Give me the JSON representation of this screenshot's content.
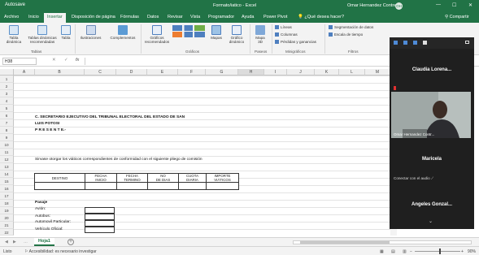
{
  "window": {
    "autosave": "Autosave",
    "title": "Formato/iatico - Excel",
    "user": "Omar Hernandez Contreras",
    "user_initials": "OH",
    "minimize": "—",
    "maximize": "☐",
    "close": "✕"
  },
  "ribbon_tabs": [
    "Archivo",
    "Inicio",
    "Insertar",
    "Disposición de página",
    "Fórmulas",
    "Datos",
    "Revisar",
    "Vista",
    "Programador",
    "Ayuda",
    "Power Pivot"
  ],
  "active_tab": "Insertar",
  "tell_me": "¿Qué desea hacer?",
  "share": "Compartir",
  "ribbon": {
    "tabla_dinamica": [
      "Tabla",
      "dinámica"
    ],
    "tablas_recomendadas": [
      "Tablas dinámicas",
      "recomendadas"
    ],
    "tabla": "Tabla",
    "ilustraciones": "Ilustraciones",
    "complementos": "Complementos",
    "graficos_recomendados": [
      "Gráficos",
      "recomendados"
    ],
    "mapas": "Mapas",
    "grafico_dinamico": [
      "Gráfico",
      "dinámico"
    ],
    "mapa_3d": [
      "Mapa",
      "3D"
    ],
    "lineas": "Líneas",
    "columnas": "Columnas",
    "perdidas": "Pérdidas y ganancias",
    "segmentacion": "Segmentación de datos",
    "escala": "Escala de tiempo",
    "groups": {
      "tablas": "Tablas",
      "graficos": "Gráficos",
      "paseos": "Paseos",
      "minigraficos": "Minigráficos",
      "filtros": "Filtros"
    }
  },
  "formula_bar": {
    "namebox": "H38",
    "cancel": "✕",
    "enter": "✓",
    "fx": "fx",
    "value": ""
  },
  "columns": [
    "A",
    "B",
    "C",
    "D",
    "E",
    "F",
    "G",
    "H",
    "I",
    "J",
    "K",
    "L",
    "M"
  ],
  "rows": [
    "1",
    "2",
    "3",
    "4",
    "5",
    "6",
    "7",
    "8",
    "9",
    "10",
    "11",
    "12",
    "13",
    "14",
    "15",
    "16",
    "17",
    "18",
    "19",
    "20",
    "21",
    "22",
    "23"
  ],
  "sheet": {
    "addressee_1": "C. SECRETARIO EJECUTIVO DEL TRIBUNAL ELECTORAL DEL ESTADO DE SAN",
    "addressee_2": "LUIS POTOSI",
    "presente": "P R E S E N T E.-",
    "request": "Sirvase otorgar los viáticos correspondientes de conformidad con el siguiente pliego de comisión",
    "table_headers": {
      "destino": "DESTINO",
      "fecha_inicio": [
        "FECHA",
        "INICIO"
      ],
      "fecha_termino": [
        "FECHA",
        "TERMINO"
      ],
      "no_dias": [
        "NO",
        "DE DIAS"
      ],
      "cuota_diaria": [
        "CUOTA",
        "DIARIA"
      ],
      "importe": [
        "IMPORTE",
        "VIÁTICOS"
      ]
    },
    "pasaje": "Pasaje",
    "transport": [
      "Avión:",
      "Autobus:",
      "Automovil Particular:",
      "Vehículo Oficial:"
    ]
  },
  "sheet_tab": "Hoja1",
  "status": {
    "mode": "Listo",
    "accessibility": "Accesibilidad: es necesario investigar",
    "zoom": "90%"
  },
  "meeting": {
    "participants": [
      "Claudia Lorena...",
      "Maricela",
      "Angeles Gonzal..."
    ],
    "video_caption": "Omar Hernandez Contr...",
    "audio_caption": "Conectar con el audio",
    "chevron": "⌄"
  },
  "colors": {
    "excel_green": "#217346",
    "ribbon_bg": "#f3f3f3",
    "meeting_bg": "#1f1f1f"
  }
}
